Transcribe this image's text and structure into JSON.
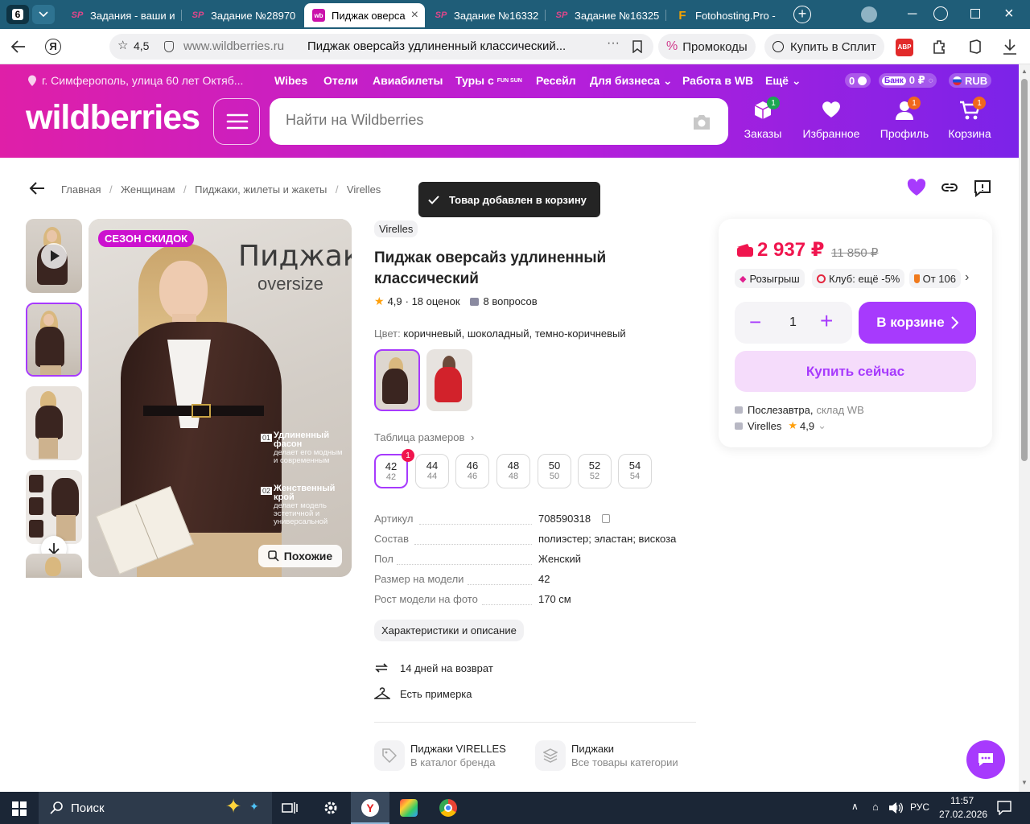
{
  "browser": {
    "tab_count": "6",
    "tabs": [
      {
        "label": "Задания - ваши и"
      },
      {
        "label": "Задание №28970"
      },
      {
        "label": "Пиджак оверса"
      },
      {
        "label": "Задание №16332"
      },
      {
        "label": "Задание №16325"
      },
      {
        "label": "Fotohosting.Pro -"
      }
    ],
    "favicon_sp": "SP",
    "favicon_wb": "wb",
    "favicon_f": "F",
    "rating": "4,5",
    "domain": "www.wildberries.ru",
    "page_title": "Пиджак оверсайз удлиненный классический...",
    "promo_label": "Промокоды",
    "split_label": "Купить в Сплит",
    "abp": "ABP"
  },
  "header": {
    "location": "г. Симферополь, улица 60 лет Октяб...",
    "nav": [
      "Wibes",
      "Отели",
      "Авиабилеты",
      "Туры с",
      "Ресейл",
      "Для бизнеса",
      "Работа в WB",
      "Ещё"
    ],
    "fun_sun": "FUN SUN",
    "points": "0",
    "bank_label": "Банк",
    "bank_value": "0 ₽",
    "currency": "RUB",
    "logo": "wildberries",
    "search_placeholder": "Найти на Wildberries",
    "icons": [
      {
        "label": "Заказы",
        "badge": "1"
      },
      {
        "label": "Избранное",
        "badge": ""
      },
      {
        "label": "Профиль",
        "badge": "1"
      },
      {
        "label": "Корзина",
        "badge": "1"
      }
    ]
  },
  "breadcrumbs": [
    "Главная",
    "Женщинам",
    "Пиджаки, жилеты и жакеты",
    "Virelles"
  ],
  "breadcrumb_sep": "/",
  "toast": "Товар добавлен в корзину",
  "gallery": {
    "badge": "СЕЗОН СКИДОК",
    "title": "Пиджак",
    "subtitle": "oversize",
    "feature1_num": "01",
    "feature1_title": "Удлиненный фасон",
    "feature1_text": "делает его модным и современным",
    "feature2_num": "02",
    "feature2_title": "Женственный крой",
    "feature2_text": "делает модель эстетичной и универсальной",
    "similar_label": "Похожие"
  },
  "product": {
    "brand": "Virelles",
    "title_line1": "Пиджак оверсайз удлиненный",
    "title_line2": "классический",
    "rating": "4,9",
    "reviews": "· 18 оценок",
    "questions": "8 вопросов",
    "color_label": "Цвет:",
    "color_value": "коричневый, шоколадный, темно-коричневый",
    "size_table": "Таблица размеров",
    "sizes": [
      {
        "ru": "42",
        "orig": "42"
      },
      {
        "ru": "44",
        "orig": "44"
      },
      {
        "ru": "46",
        "orig": "46"
      },
      {
        "ru": "48",
        "orig": "48"
      },
      {
        "ru": "50",
        "orig": "50"
      },
      {
        "ru": "52",
        "orig": "52"
      },
      {
        "ru": "54",
        "orig": "54"
      }
    ],
    "size_badge": "1",
    "specs": [
      {
        "label": "Артикул",
        "value": "708590318"
      },
      {
        "label": "Состав",
        "value": "полиэстер; эластан; вискоза"
      },
      {
        "label": "Пол",
        "value": "Женский"
      },
      {
        "label": "Размер на модели",
        "value": "42"
      },
      {
        "label": "Рост модели на фото",
        "value": "170 см"
      }
    ],
    "specs_button": "Характеристики и описание",
    "return": "14 дней на возврат",
    "fitting": "Есть примерка",
    "link1_title": "Пиджаки VIRELLES",
    "link1_sub": "В каталог бренда",
    "link2_title": "Пиджаки",
    "link2_sub": "Все товары категории"
  },
  "buybox": {
    "price": "2 937 ₽",
    "old_price": "11 850 ₽",
    "chips": [
      "Розыгрыш",
      "Клуб: ещё -5%",
      "От 106"
    ],
    "qty": "1",
    "cart_button": "В корзине",
    "buy_now": "Купить сейчас",
    "delivery": "Послезавтра,",
    "warehouse": "склад WB",
    "seller": "Virelles",
    "seller_rating": "4,9"
  },
  "taskbar": {
    "search": "Поиск",
    "lang": "РУС",
    "time": "11:57",
    "date": "27.02.2026"
  },
  "colors": {
    "accent": "#a73afd",
    "price": "#f0154e",
    "header_start": "#df1fa8",
    "header_end": "#7a23e9"
  }
}
